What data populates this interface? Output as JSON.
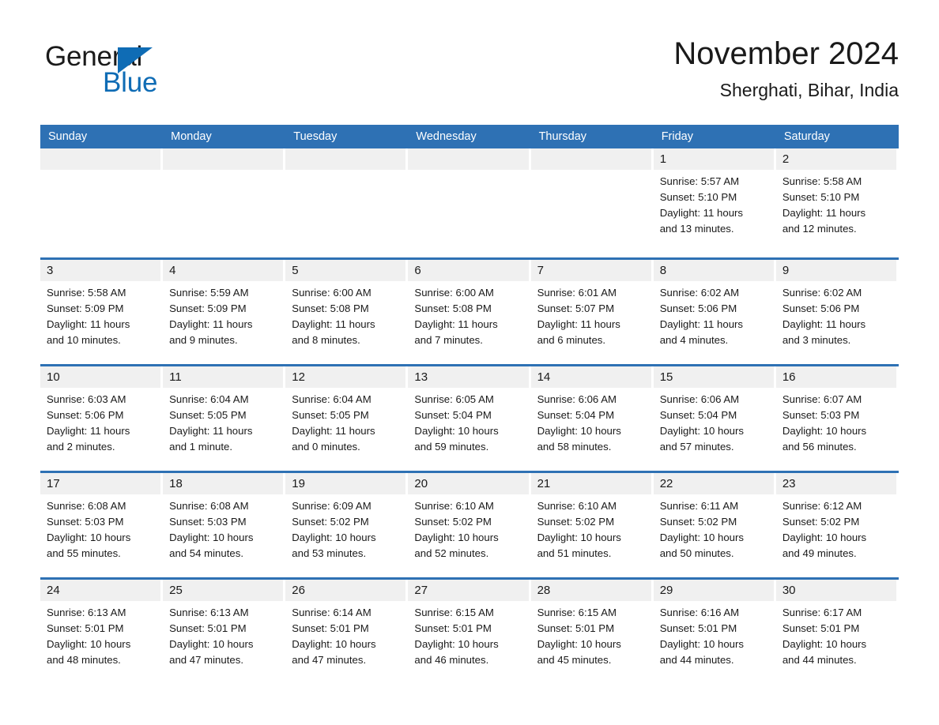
{
  "brand": {
    "name_part1": "General",
    "name_part2": "Blue",
    "accent_color": "#0f6cb5"
  },
  "header": {
    "title": "November 2024",
    "location": "Sherghati, Bihar, India"
  },
  "theme": {
    "header_blue": "#2e71b4",
    "day_band_gray": "#f0f0f0",
    "text_color": "#1a1a1a"
  },
  "weekdays": [
    "Sunday",
    "Monday",
    "Tuesday",
    "Wednesday",
    "Thursday",
    "Friday",
    "Saturday"
  ],
  "weeks": [
    [
      {
        "date": "",
        "empty": true
      },
      {
        "date": "",
        "empty": true
      },
      {
        "date": "",
        "empty": true
      },
      {
        "date": "",
        "empty": true
      },
      {
        "date": "",
        "empty": true
      },
      {
        "date": "1",
        "sunrise": "Sunrise: 5:57 AM",
        "sunset": "Sunset: 5:10 PM",
        "daylight_1": "Daylight: 11 hours",
        "daylight_2": "and 13 minutes."
      },
      {
        "date": "2",
        "sunrise": "Sunrise: 5:58 AM",
        "sunset": "Sunset: 5:10 PM",
        "daylight_1": "Daylight: 11 hours",
        "daylight_2": "and 12 minutes."
      }
    ],
    [
      {
        "date": "3",
        "sunrise": "Sunrise: 5:58 AM",
        "sunset": "Sunset: 5:09 PM",
        "daylight_1": "Daylight: 11 hours",
        "daylight_2": "and 10 minutes."
      },
      {
        "date": "4",
        "sunrise": "Sunrise: 5:59 AM",
        "sunset": "Sunset: 5:09 PM",
        "daylight_1": "Daylight: 11 hours",
        "daylight_2": "and 9 minutes."
      },
      {
        "date": "5",
        "sunrise": "Sunrise: 6:00 AM",
        "sunset": "Sunset: 5:08 PM",
        "daylight_1": "Daylight: 11 hours",
        "daylight_2": "and 8 minutes."
      },
      {
        "date": "6",
        "sunrise": "Sunrise: 6:00 AM",
        "sunset": "Sunset: 5:08 PM",
        "daylight_1": "Daylight: 11 hours",
        "daylight_2": "and 7 minutes."
      },
      {
        "date": "7",
        "sunrise": "Sunrise: 6:01 AM",
        "sunset": "Sunset: 5:07 PM",
        "daylight_1": "Daylight: 11 hours",
        "daylight_2": "and 6 minutes."
      },
      {
        "date": "8",
        "sunrise": "Sunrise: 6:02 AM",
        "sunset": "Sunset: 5:06 PM",
        "daylight_1": "Daylight: 11 hours",
        "daylight_2": "and 4 minutes."
      },
      {
        "date": "9",
        "sunrise": "Sunrise: 6:02 AM",
        "sunset": "Sunset: 5:06 PM",
        "daylight_1": "Daylight: 11 hours",
        "daylight_2": "and 3 minutes."
      }
    ],
    [
      {
        "date": "10",
        "sunrise": "Sunrise: 6:03 AM",
        "sunset": "Sunset: 5:06 PM",
        "daylight_1": "Daylight: 11 hours",
        "daylight_2": "and 2 minutes."
      },
      {
        "date": "11",
        "sunrise": "Sunrise: 6:04 AM",
        "sunset": "Sunset: 5:05 PM",
        "daylight_1": "Daylight: 11 hours",
        "daylight_2": "and 1 minute."
      },
      {
        "date": "12",
        "sunrise": "Sunrise: 6:04 AM",
        "sunset": "Sunset: 5:05 PM",
        "daylight_1": "Daylight: 11 hours",
        "daylight_2": "and 0 minutes."
      },
      {
        "date": "13",
        "sunrise": "Sunrise: 6:05 AM",
        "sunset": "Sunset: 5:04 PM",
        "daylight_1": "Daylight: 10 hours",
        "daylight_2": "and 59 minutes."
      },
      {
        "date": "14",
        "sunrise": "Sunrise: 6:06 AM",
        "sunset": "Sunset: 5:04 PM",
        "daylight_1": "Daylight: 10 hours",
        "daylight_2": "and 58 minutes."
      },
      {
        "date": "15",
        "sunrise": "Sunrise: 6:06 AM",
        "sunset": "Sunset: 5:04 PM",
        "daylight_1": "Daylight: 10 hours",
        "daylight_2": "and 57 minutes."
      },
      {
        "date": "16",
        "sunrise": "Sunrise: 6:07 AM",
        "sunset": "Sunset: 5:03 PM",
        "daylight_1": "Daylight: 10 hours",
        "daylight_2": "and 56 minutes."
      }
    ],
    [
      {
        "date": "17",
        "sunrise": "Sunrise: 6:08 AM",
        "sunset": "Sunset: 5:03 PM",
        "daylight_1": "Daylight: 10 hours",
        "daylight_2": "and 55 minutes."
      },
      {
        "date": "18",
        "sunrise": "Sunrise: 6:08 AM",
        "sunset": "Sunset: 5:03 PM",
        "daylight_1": "Daylight: 10 hours",
        "daylight_2": "and 54 minutes."
      },
      {
        "date": "19",
        "sunrise": "Sunrise: 6:09 AM",
        "sunset": "Sunset: 5:02 PM",
        "daylight_1": "Daylight: 10 hours",
        "daylight_2": "and 53 minutes."
      },
      {
        "date": "20",
        "sunrise": "Sunrise: 6:10 AM",
        "sunset": "Sunset: 5:02 PM",
        "daylight_1": "Daylight: 10 hours",
        "daylight_2": "and 52 minutes."
      },
      {
        "date": "21",
        "sunrise": "Sunrise: 6:10 AM",
        "sunset": "Sunset: 5:02 PM",
        "daylight_1": "Daylight: 10 hours",
        "daylight_2": "and 51 minutes."
      },
      {
        "date": "22",
        "sunrise": "Sunrise: 6:11 AM",
        "sunset": "Sunset: 5:02 PM",
        "daylight_1": "Daylight: 10 hours",
        "daylight_2": "and 50 minutes."
      },
      {
        "date": "23",
        "sunrise": "Sunrise: 6:12 AM",
        "sunset": "Sunset: 5:02 PM",
        "daylight_1": "Daylight: 10 hours",
        "daylight_2": "and 49 minutes."
      }
    ],
    [
      {
        "date": "24",
        "sunrise": "Sunrise: 6:13 AM",
        "sunset": "Sunset: 5:01 PM",
        "daylight_1": "Daylight: 10 hours",
        "daylight_2": "and 48 minutes."
      },
      {
        "date": "25",
        "sunrise": "Sunrise: 6:13 AM",
        "sunset": "Sunset: 5:01 PM",
        "daylight_1": "Daylight: 10 hours",
        "daylight_2": "and 47 minutes."
      },
      {
        "date": "26",
        "sunrise": "Sunrise: 6:14 AM",
        "sunset": "Sunset: 5:01 PM",
        "daylight_1": "Daylight: 10 hours",
        "daylight_2": "and 47 minutes."
      },
      {
        "date": "27",
        "sunrise": "Sunrise: 6:15 AM",
        "sunset": "Sunset: 5:01 PM",
        "daylight_1": "Daylight: 10 hours",
        "daylight_2": "and 46 minutes."
      },
      {
        "date": "28",
        "sunrise": "Sunrise: 6:15 AM",
        "sunset": "Sunset: 5:01 PM",
        "daylight_1": "Daylight: 10 hours",
        "daylight_2": "and 45 minutes."
      },
      {
        "date": "29",
        "sunrise": "Sunrise: 6:16 AM",
        "sunset": "Sunset: 5:01 PM",
        "daylight_1": "Daylight: 10 hours",
        "daylight_2": "and 44 minutes."
      },
      {
        "date": "30",
        "sunrise": "Sunrise: 6:17 AM",
        "sunset": "Sunset: 5:01 PM",
        "daylight_1": "Daylight: 10 hours",
        "daylight_2": "and 44 minutes."
      }
    ]
  ]
}
